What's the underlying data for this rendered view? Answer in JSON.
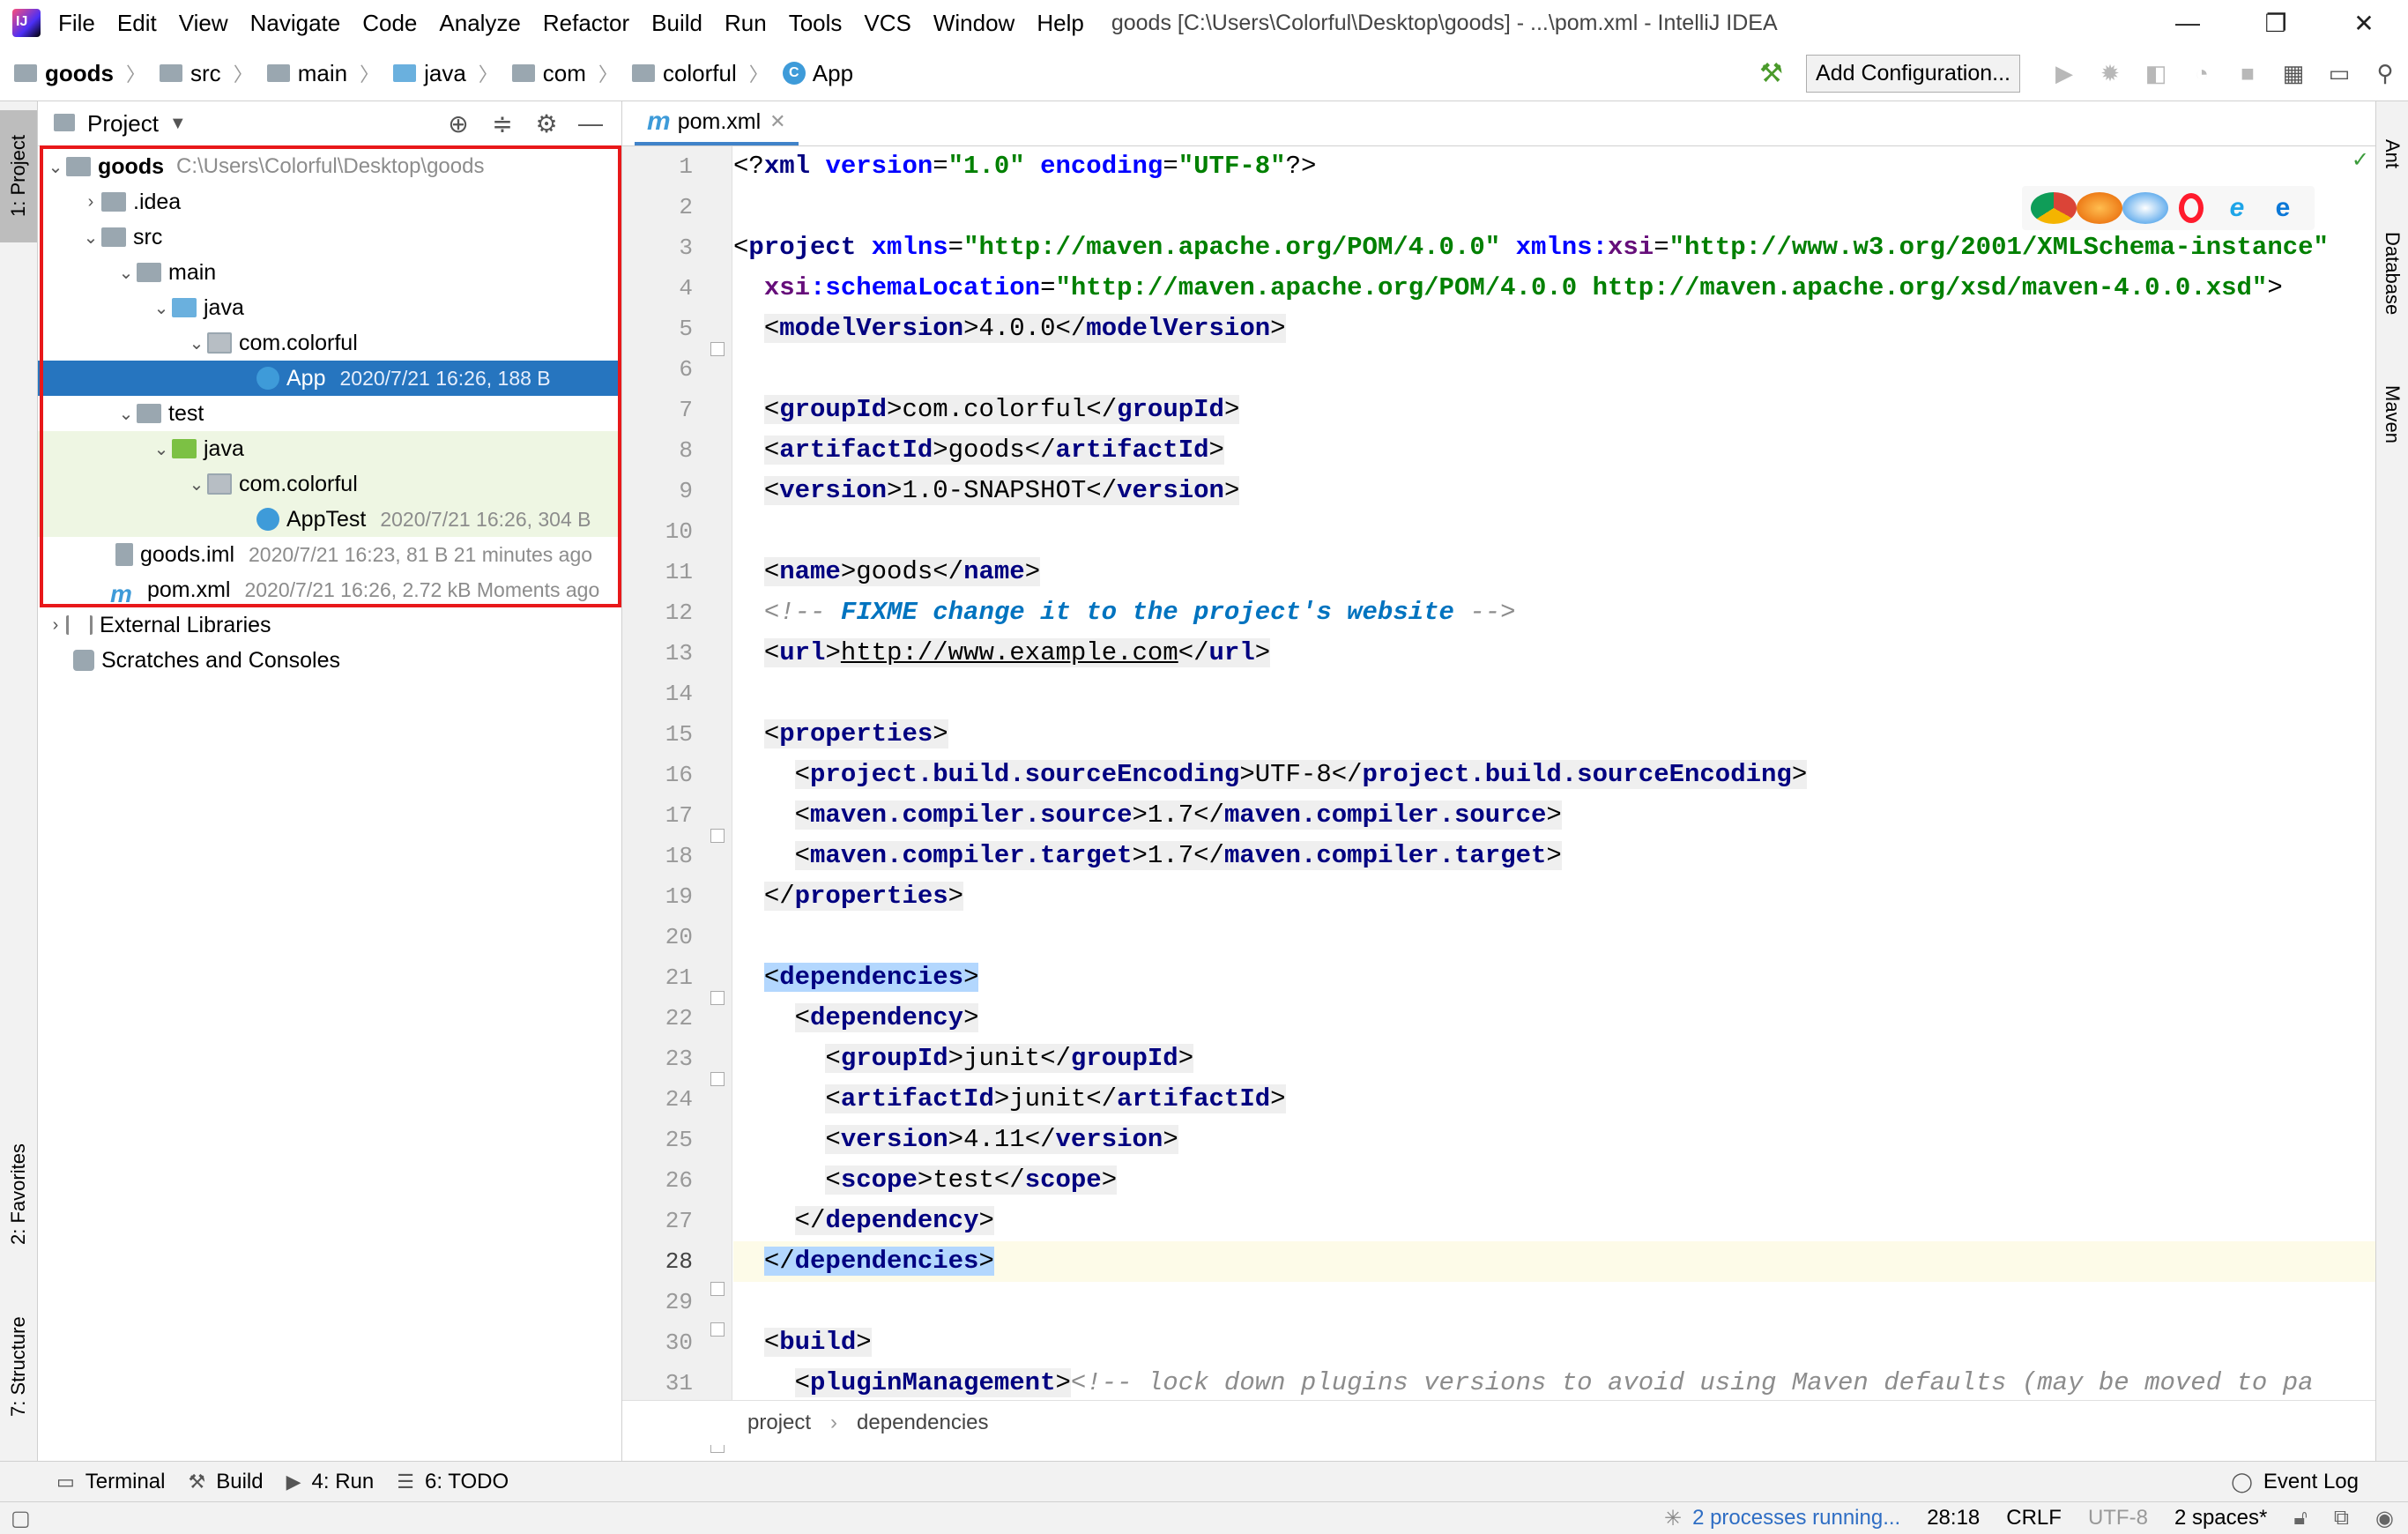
{
  "window": {
    "title": "goods [C:\\Users\\Colorful\\Desktop\\goods] - ...\\pom.xml - IntelliJ IDEA",
    "menu": [
      "File",
      "Edit",
      "View",
      "Navigate",
      "Code",
      "Analyze",
      "Refactor",
      "Build",
      "Run",
      "Tools",
      "VCS",
      "Window",
      "Help"
    ],
    "minimize": "—",
    "restore": "❐",
    "close": "✕"
  },
  "navbar": {
    "crumbs": [
      "goods",
      "src",
      "main",
      "java",
      "com",
      "colorful",
      "App"
    ],
    "add_config": "Add Configuration..."
  },
  "left_tabs": {
    "project": "1: Project",
    "favorites": "2: Favorites",
    "structure": "7: Structure"
  },
  "right_tabs": {
    "ant": "Ant",
    "database": "Database",
    "maven": "Maven"
  },
  "project_panel": {
    "title": "Project",
    "tree": [
      {
        "label": "goods",
        "path": "C:\\Users\\Colorful\\Desktop\\goods"
      },
      {
        "label": ".idea"
      },
      {
        "label": "src"
      },
      {
        "label": "main"
      },
      {
        "label": "java"
      },
      {
        "label": "com.colorful"
      },
      {
        "label": "App",
        "meta": "2020/7/21 16:26, 188 B"
      },
      {
        "label": "test"
      },
      {
        "label": "java"
      },
      {
        "label": "com.colorful"
      },
      {
        "label": "AppTest",
        "meta": "2020/7/21 16:26, 304 B"
      },
      {
        "label": "goods.iml",
        "meta": "2020/7/21 16:23, 81 B 21 minutes ago"
      },
      {
        "label": "pom.xml",
        "meta": "2020/7/21 16:26, 2.72 kB Moments ago"
      },
      {
        "label": "External Libraries"
      },
      {
        "label": "Scratches and Consoles"
      }
    ]
  },
  "editor": {
    "tab": "pom.xml",
    "current_line": 28,
    "line_numbers": [
      "1",
      "2",
      "3",
      "4",
      "5",
      "6",
      "7",
      "8",
      "9",
      "10",
      "11",
      "12",
      "13",
      "14",
      "15",
      "16",
      "17",
      "18",
      "19",
      "20",
      "21",
      "22",
      "23",
      "24",
      "25",
      "26",
      "27",
      "28",
      "29",
      "30",
      "31"
    ],
    "code": {
      "l1_a": "<?",
      "l1_b": "xml ",
      "l1_c": "version",
      "l1_d": "=",
      "l1_e": "\"1.0\"",
      "l1_f": " encoding",
      "l1_g": "=",
      "l1_h": "\"UTF-8\"",
      "l1_i": "?>",
      "l3_a": "<",
      "l3_b": "project ",
      "l3_c": "xmlns",
      "l3_d": "=",
      "l3_e": "\"http://maven.apache.org/POM/4.0.0\"",
      "l3_f": " xmlns:",
      "l3_g": "xsi",
      "l3_h": "=",
      "l3_i": "\"http://www.w3.org/2001/XMLSchema-instance\"",
      "l4_a": "xsi",
      "l4_b": ":schemaLocation",
      "l4_c": "=",
      "l4_d": "\"http://maven.apache.org/POM/4.0.0 http://maven.apache.org/xsd/maven-4.0.0.xsd\"",
      "l4_e": ">",
      "modelVersion": "modelVersion",
      "modelVersion_val": "4.0.0",
      "groupId": "groupId",
      "groupId_val": "com.colorful",
      "artifactId": "artifactId",
      "artifactId_val": "goods",
      "version": "version",
      "version_val": "1.0-SNAPSHOT",
      "name": "name",
      "name_val": "goods",
      "comment_open": "<!-- ",
      "todo": "FIXME change it to the project's website",
      "comment_close": " -->",
      "url": "url",
      "url_val": "http://www.example.com",
      "properties": "properties",
      "p1": "project.build.sourceEncoding",
      "p1_val": "UTF-8",
      "p2": "maven.compiler.source",
      "p2_val": "1.7",
      "p3": "maven.compiler.target",
      "p3_val": "1.7",
      "dependencies": "dependencies",
      "dependency": "dependency",
      "d_groupId_val": "junit",
      "d_artifactId_val": "junit",
      "d_version_val": "4.11",
      "scope": "scope",
      "scope_val": "test",
      "build": "build",
      "pluginManagement": "pluginManagement",
      "l31_comment": "<!-- lock down plugins versions to avoid using Maven defaults (may be moved to pa"
    },
    "breadcrumbs": [
      "project",
      "dependencies"
    ]
  },
  "toolwindows": {
    "terminal": "Terminal",
    "build": "Build",
    "run": "4: Run",
    "todo": "6: TODO",
    "event_log": "Event Log"
  },
  "status": {
    "processes": "2 processes running...",
    "position": "28:18",
    "line_sep": "CRLF",
    "encoding": "UTF-8",
    "indent": "2 spaces*"
  }
}
